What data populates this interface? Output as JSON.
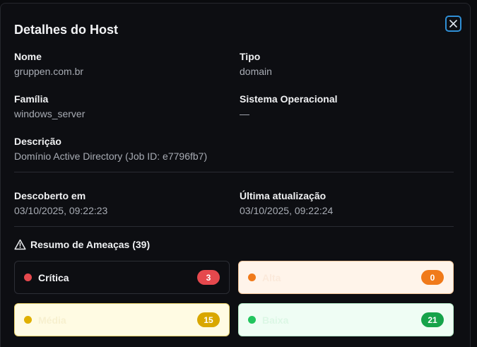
{
  "modal": {
    "title": "Detalhes do Host",
    "close_icon": "close-icon"
  },
  "fields": {
    "nome": {
      "label": "Nome",
      "value": "gruppen.com.br"
    },
    "tipo": {
      "label": "Tipo",
      "value": "domain"
    },
    "familia": {
      "label": "Família",
      "value": "windows_server"
    },
    "sistema": {
      "label": "Sistema Operacional",
      "value": "—"
    },
    "descricao": {
      "label": "Descrição",
      "value": "Domínio Active Directory (Job ID: e7796fb7)"
    },
    "descoberto": {
      "label": "Descoberto em",
      "value": "03/10/2025, 09:22:23"
    },
    "atualizacao": {
      "label": "Última atualização",
      "value": "03/10/2025, 09:22:24"
    }
  },
  "threats": {
    "heading": "Resumo de Ameaças (39)",
    "icon": "warning-triangle-icon",
    "severities": [
      {
        "label": "Crítica",
        "count": "3",
        "dot_color": "#e5484d",
        "badge_color": "#e5484d",
        "bg": "#0d0e12",
        "border": "#2c2e35",
        "text_color": "#f2f3f5"
      },
      {
        "label": "Alta",
        "count": "0",
        "dot_color": "#f07a1a",
        "badge_color": "#f07a1a",
        "bg": "#fff4ea",
        "border": "#f6c79c",
        "text_color": "#fbe9da"
      },
      {
        "label": "Média",
        "count": "15",
        "dot_color": "#e0b000",
        "badge_color": "#d9a700",
        "bg": "#fffbe3",
        "border": "#ecd36a",
        "text_color": "#f7f0cf"
      },
      {
        "label": "Baixa",
        "count": "21",
        "dot_color": "#22c55e",
        "badge_color": "#16a34a",
        "bg": "#effdf4",
        "border": "#b8ecc9",
        "text_color": "#dcf7e5"
      }
    ]
  }
}
